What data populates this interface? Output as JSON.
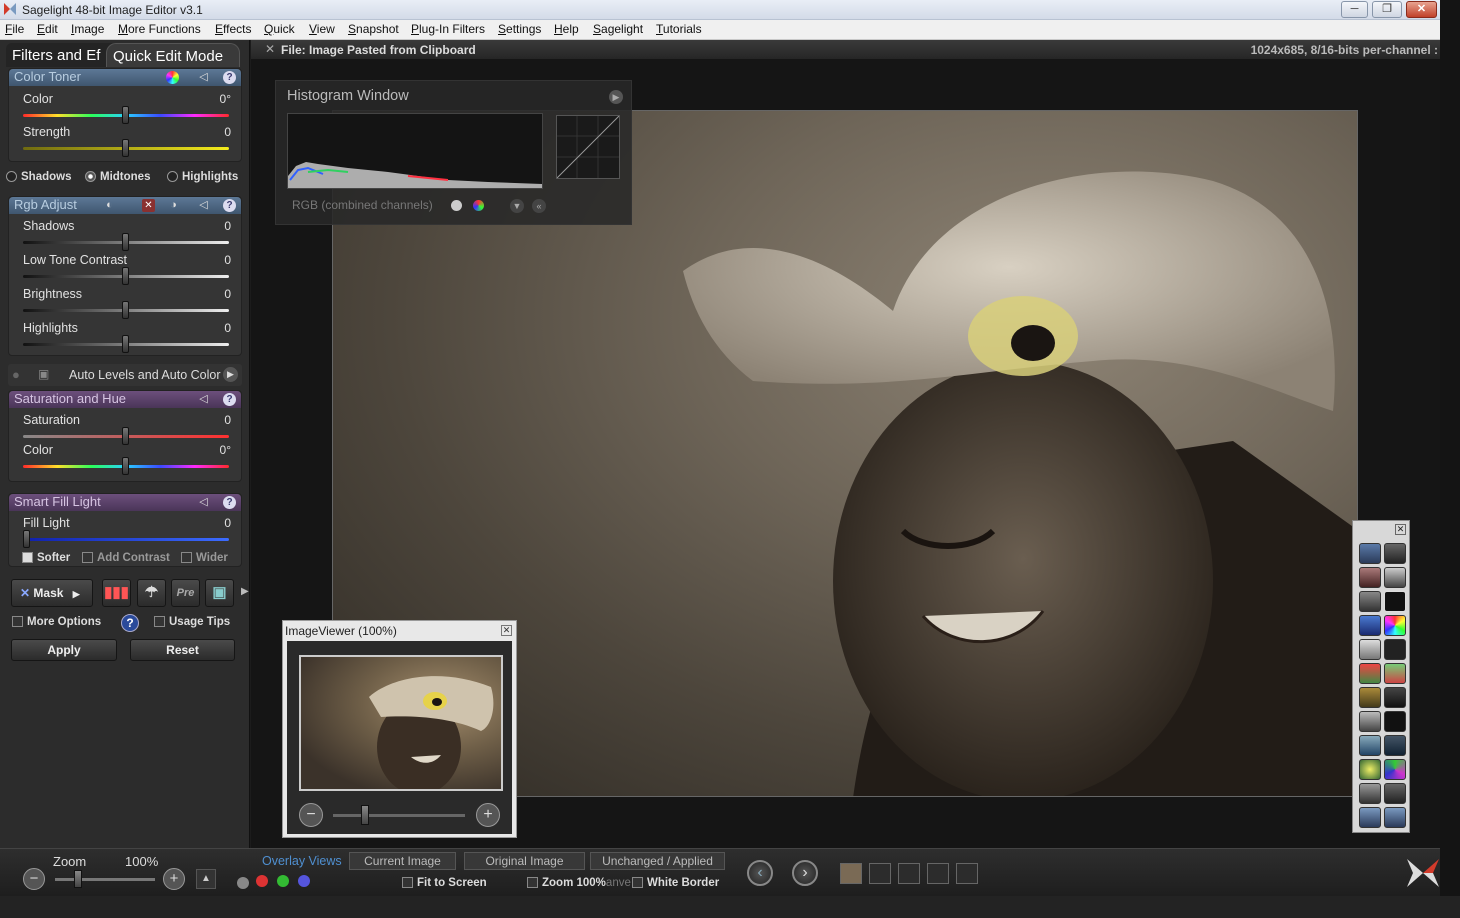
{
  "window": {
    "title": "Sagelight 48-bit Image Editor v3.1",
    "min": "─",
    "max": "❐",
    "close": "✕"
  },
  "menu": [
    "File",
    "Edit",
    "Image",
    "More Functions",
    "Effects",
    "Quick",
    "View",
    "Snapshot",
    "Plug-In Filters",
    "Settings",
    "Help",
    "Sagelight",
    "Tutorials"
  ],
  "left_panel": {
    "tabs": {
      "filters": "Filters and Ef",
      "quick": "Quick Edit Mode"
    },
    "color_toner": {
      "title": "Color Toner",
      "color": {
        "label": "Color",
        "value": "0°",
        "level": 0.5
      },
      "strength": {
        "label": "Strength",
        "value": "0",
        "level": 0.5
      }
    },
    "tone_radios": {
      "shadows": "Shadows",
      "midtones": "Midtones",
      "highlights": "Highlights",
      "selected": "Midtones"
    },
    "rgb_adjust": {
      "title": "Rgb Adjust",
      "sliders": [
        {
          "label": "Shadows",
          "value": "0",
          "level": 0.5
        },
        {
          "label": "Low Tone Contrast",
          "value": "0",
          "level": 0.5
        },
        {
          "label": "Brightness",
          "value": "0",
          "level": 0.5
        },
        {
          "label": "Highlights",
          "value": "0",
          "level": 0.5
        }
      ]
    },
    "auto_levels": "Auto Levels and Auto Color",
    "saturation_hue": {
      "title": "Saturation and Hue",
      "saturation": {
        "label": "Saturation",
        "value": "0",
        "level": 0.5
      },
      "color": {
        "label": "Color",
        "value": "0°",
        "level": 0.5
      }
    },
    "smart_fill": {
      "title": "Smart Fill Light",
      "fill": {
        "label": "Fill Light",
        "value": "0",
        "level": 0
      },
      "softer": "Softer",
      "add_contrast": "Add Contrast",
      "wider": "Wider"
    },
    "mask_button": "Mask",
    "more_options": "More Options",
    "usage_tips": "Usage Tips",
    "apply": "Apply",
    "reset": "Reset"
  },
  "file_bar": {
    "file": "File: Image Pasted from Clipboard",
    "info": "1024x685, 8/16-bits per-channel :"
  },
  "histogram": {
    "title": "Histogram Window",
    "channel": "RGB (combined channels)"
  },
  "image_viewer": {
    "title": "ImageViewer (100%)",
    "close": "✕",
    "minus": "−",
    "plus": "+"
  },
  "tools": {
    "close": "✕"
  },
  "bottom": {
    "zoom_label": "Zoom",
    "zoom_value": "100%",
    "overlay_views": "Overlay Views",
    "tabs": [
      "Current Image",
      "Original Image",
      "Unchanged / Applied"
    ],
    "fit_to_screen": "Fit to Screen",
    "zoom_100": "Zoom 100%",
    "zoom_suffix": "anve",
    "white_border": "White Border"
  },
  "colors": {
    "accent_blue": "#3f566f",
    "accent_purple": "#4a3558",
    "overlay_blue": "#4f8fd0"
  }
}
